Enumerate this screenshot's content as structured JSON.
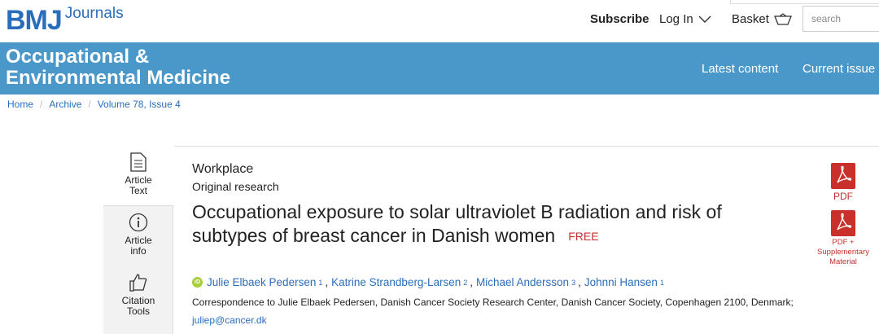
{
  "header": {
    "logo_bmj": "BMJ",
    "logo_journals": "Journals",
    "subscribe": "Subscribe",
    "login": "Log In",
    "basket": "Basket",
    "search_placeholder": "search"
  },
  "banner": {
    "journal_title_line1": "Occupational &",
    "journal_title_line2": "Environmental Medicine",
    "latest_content": "Latest content",
    "current_issue": "Current issue",
    "color": "#4a97c9"
  },
  "breadcrumb": [
    "Home",
    "Archive",
    "Volume 78, Issue 4"
  ],
  "side_tabs": {
    "article_text_line1": "Article",
    "article_text_line2": "Text",
    "article_info_line1": "Article",
    "article_info_line2": "info",
    "citation_line1": "Citation",
    "citation_line2": "Tools"
  },
  "article": {
    "section": "Workplace",
    "subsection": "Original research",
    "title_line1": "Occupational exposure to solar ultraviolet B radiation and risk of",
    "title_line2": "subtypes of breast cancer in Danish women",
    "free_badge": "FREE",
    "authors": [
      {
        "name": "Julie Elbaek Pedersen",
        "aff": "1"
      },
      {
        "name": "Katrine Strandberg-Larsen",
        "aff": "2"
      },
      {
        "name": "Michael Andersson",
        "aff": "3"
      },
      {
        "name": "Johnni Hansen",
        "aff": "1"
      }
    ],
    "orcid_label": "iD",
    "correspondence": "Correspondence to Julie Elbaek Pedersen, Danish Cancer Society Research Center, Danish Cancer Society, Copenhagen 2100, Denmark;",
    "email": "juliep@cancer.dk"
  },
  "downloads": {
    "pdf": "PDF",
    "pdf_supp_line1": "PDF +",
    "pdf_supp_line2": "Supplementary",
    "pdf_supp_line3": "Material",
    "color": "#c9302c"
  }
}
